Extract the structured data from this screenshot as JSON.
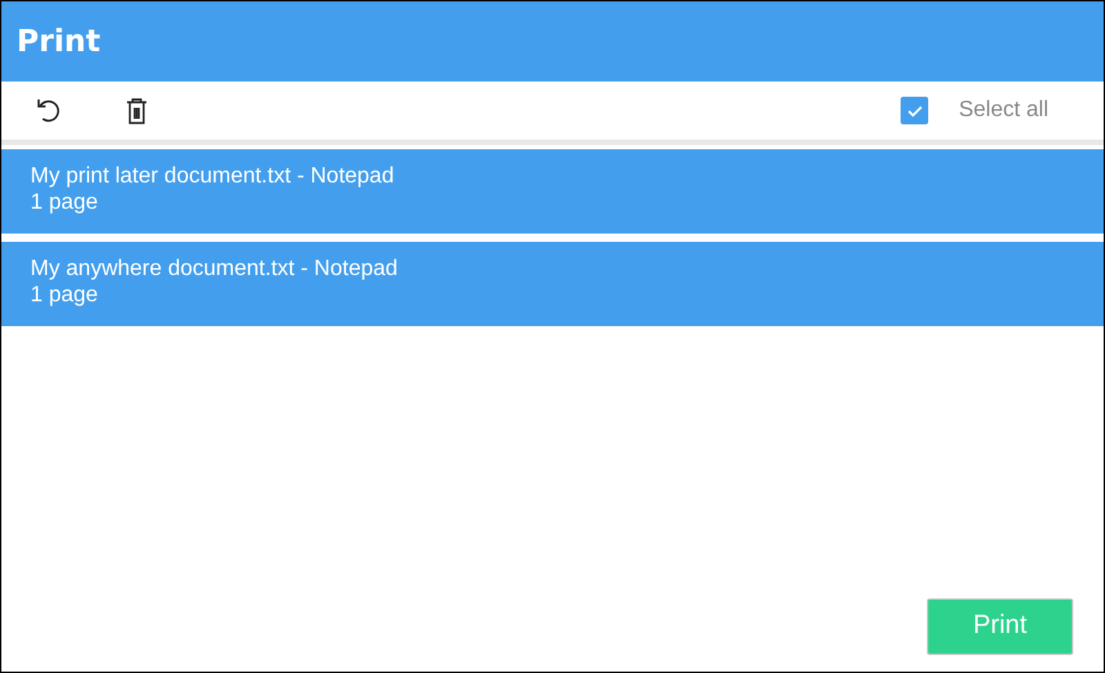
{
  "window": {
    "title": "Print"
  },
  "toolbar": {
    "select_all": {
      "label": "Select all",
      "checked": true
    }
  },
  "jobs": [
    {
      "name": "My print later document.txt - Notepad",
      "pages": "1 page",
      "selected": true
    },
    {
      "name": "My anywhere document.txt - Notepad",
      "pages": "1 page",
      "selected": true
    }
  ],
  "buttons": [
    {
      "label": "Print"
    }
  ]
}
